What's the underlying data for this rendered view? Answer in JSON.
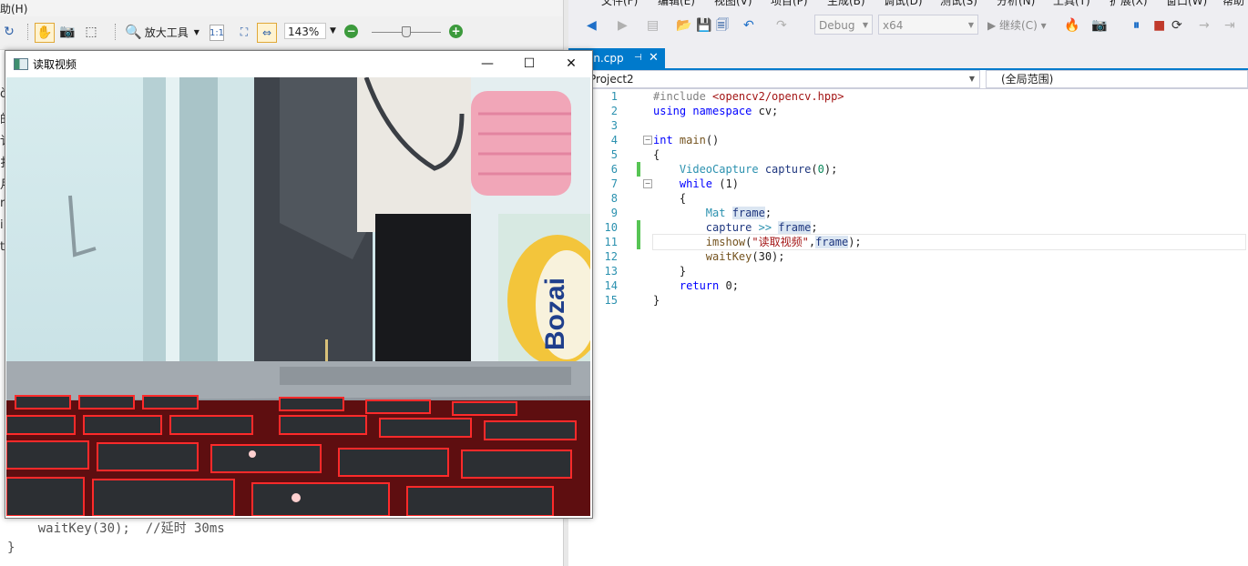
{
  "left_app": {
    "menu_help": "助(H)",
    "toolbar": {
      "zoom_tool_label": "放大工具",
      "zoom_value": "143%",
      "zoom_level_fraction": 0.49
    },
    "margin_chars": [
      "ò",
      "的",
      "讠",
      "扌",
      "月",
      "r",
      "i",
      "t"
    ],
    "code_bottom": [
      "    waitKey(30);  //延时 30ms",
      "}"
    ]
  },
  "video_window": {
    "title": "读取视频",
    "minimize_glyph": "—",
    "maximize_glyph": "☐",
    "close_glyph": "✕",
    "label_text": "Bozai"
  },
  "ide": {
    "menu_items": [
      "文件(F)",
      "编辑(E)",
      "视图(V)",
      "项目(P)",
      "生成(B)",
      "调试(D)",
      "测试(S)",
      "分析(N)",
      "工具(T)",
      "扩展(X)",
      "窗口(W)",
      "帮助(H)"
    ],
    "toolbar": {
      "config": "Debug",
      "platform": "x64",
      "continue_label": "继续(C)"
    },
    "tab": {
      "label": "in.cpp",
      "pin": "⊣",
      "close": "✕"
    },
    "nav": {
      "project": "Project2",
      "scope": "(全局范围)"
    },
    "code": {
      "line_numbers": [
        "1",
        "2",
        "3",
        "4",
        "5",
        "6",
        "7",
        "8",
        "9",
        "10",
        "11",
        "12",
        "13",
        "14",
        "15"
      ],
      "lines": [
        {
          "indent": "",
          "tokens": [
            [
              "pp",
              "#include "
            ],
            [
              "str",
              "<opencv2/opencv.hpp>"
            ]
          ]
        },
        {
          "indent": "",
          "tokens": [
            [
              "kw",
              "using namespace "
            ],
            [
              "",
              "cv;"
            ]
          ]
        },
        {
          "indent": "",
          "tokens": []
        },
        {
          "indent": "",
          "tokens": [
            [
              "kw",
              "int "
            ],
            [
              "fn",
              "main"
            ],
            [
              "",
              "()"
            ]
          ]
        },
        {
          "indent": "",
          "tokens": [
            [
              "",
              "{"
            ]
          ]
        },
        {
          "indent": "    ",
          "tokens": [
            [
              "ty",
              "VideoCapture "
            ],
            [
              "var",
              "capture"
            ],
            [
              "",
              "("
            ],
            [
              "num",
              "0"
            ],
            [
              "",
              "); "
            ]
          ]
        },
        {
          "indent": "    ",
          "tokens": [
            [
              "kw",
              "while "
            ],
            [
              "",
              "(1)"
            ]
          ]
        },
        {
          "indent": "    ",
          "tokens": [
            [
              "",
              "{"
            ]
          ]
        },
        {
          "indent": "        ",
          "tokens": [
            [
              "ty",
              "Mat "
            ],
            [
              "var hl",
              "frame"
            ],
            [
              "",
              ";"
            ]
          ]
        },
        {
          "indent": "        ",
          "tokens": [
            [
              "var",
              "capture "
            ],
            [
              "ty",
              ">> "
            ],
            [
              "var hl",
              "frame"
            ],
            [
              "",
              ";"
            ]
          ]
        },
        {
          "indent": "        ",
          "tokens": [
            [
              "fn",
              "imshow"
            ],
            [
              "",
              "("
            ],
            [
              "str",
              "\"读取视频\""
            ],
            [
              "",
              ","
            ],
            [
              "var hl",
              "frame"
            ],
            [
              "",
              ");"
            ]
          ]
        },
        {
          "indent": "        ",
          "tokens": [
            [
              "fn",
              "waitKey"
            ],
            [
              "",
              "(30);"
            ]
          ]
        },
        {
          "indent": "    ",
          "tokens": [
            [
              "",
              "}"
            ]
          ]
        },
        {
          "indent": "    ",
          "tokens": [
            [
              "kw",
              "return "
            ],
            [
              "",
              "0;"
            ]
          ]
        },
        {
          "indent": "",
          "tokens": [
            [
              "",
              "}"
            ]
          ]
        }
      ],
      "changed_lines": [
        6,
        10,
        11
      ],
      "fold_lines": [
        4,
        7
      ],
      "current_line": 11
    }
  }
}
